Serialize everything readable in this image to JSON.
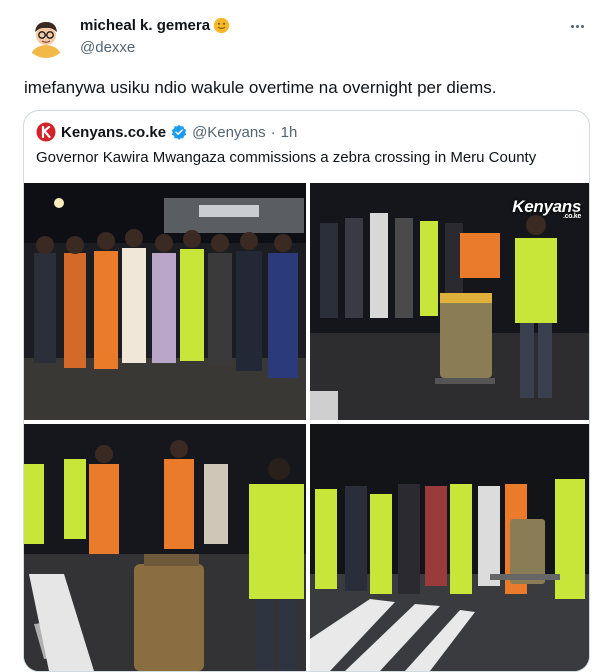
{
  "tweet": {
    "author_name": "micheal k. gemera",
    "author_handle": "@dexxe",
    "text": "imefanywa usiku ndio wakule overtime na overnight per diems.",
    "avatar_icon": "cartoon-avatar-icon",
    "badge_icon": "emoji-badge-icon",
    "more_icon": "more-options-icon"
  },
  "quote": {
    "account_name": "Kenyans.co.ke",
    "account_handle": "@Kenyans",
    "separator": "·",
    "time": "1h",
    "text": "Governor Kawira Mwangaza commissions a zebra crossing in Meru County",
    "logo_icon": "kenyans-logo-icon",
    "verified_icon": "verified-badge-icon",
    "watermark": "Kenyans",
    "watermark_suffix": ".co.ke"
  },
  "colors": {
    "text_primary": "#0f1419",
    "text_secondary": "#536471",
    "border": "#cfd9de",
    "verified": "#1d9bf0",
    "kenyans_red": "#d3222a",
    "hi_vis": "#c8e63a"
  }
}
